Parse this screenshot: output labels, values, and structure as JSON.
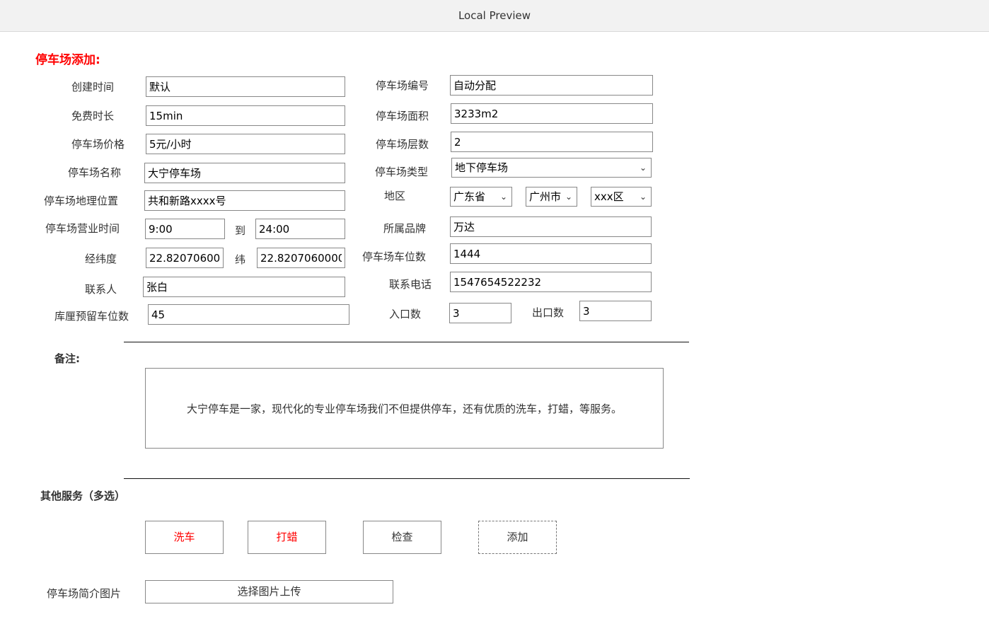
{
  "window": {
    "title": "Local Preview"
  },
  "page": {
    "heading": "停车场添加:"
  },
  "left": {
    "create_time": {
      "label": "创建时间",
      "value": "默认"
    },
    "free_duration": {
      "label": "免费时长",
      "value": "15min"
    },
    "price": {
      "label": "停车场价格",
      "value": "5元/小时"
    },
    "name": {
      "label": "停车场名称",
      "value": "大宁停车场"
    },
    "location": {
      "label": "停车场地理位置",
      "value": "共和新路xxxx号"
    },
    "hours": {
      "label": "停车场营业时间",
      "from": "9:00",
      "to_label": "到",
      "to": "24:00"
    },
    "coords": {
      "label": "经纬度",
      "lng": "22.82070600",
      "lat_label": "纬",
      "lat": "22.8207060000"
    },
    "contact": {
      "label": "联系人",
      "value": "张白"
    },
    "reserved": {
      "label": "库厘预留车位数",
      "value": "45"
    }
  },
  "right": {
    "number": {
      "label": "停车场编号",
      "value": "自动分配"
    },
    "area": {
      "label": "停车场面积",
      "value": "3233m2"
    },
    "floors": {
      "label": "停车场层数",
      "value": "2"
    },
    "type": {
      "label": "停车场类型",
      "value": "地下停车场"
    },
    "region": {
      "label": "地区",
      "province": "广东省",
      "city": "广州市",
      "district": "xxx区"
    },
    "brand": {
      "label": "所属品牌",
      "value": "万达"
    },
    "spaces": {
      "label": "停车场车位数",
      "value": "1444"
    },
    "phone": {
      "label": "联系电话",
      "value": "1547654522232"
    },
    "entrances": {
      "label": "入口数",
      "value": "3"
    },
    "exits": {
      "label": "出口数",
      "value": "3"
    }
  },
  "remarks": {
    "label": "备注:",
    "text": "大宁停车是一家，现代化的专业停车场我们不但提供停车，还有优质的洗车，打蜡，等服务。"
  },
  "services": {
    "label": "其他服务（多选）",
    "items": [
      "洗车",
      "打蜡",
      "检查"
    ],
    "add_label": "添加"
  },
  "image": {
    "label": "停车场简介图片",
    "button": "选择图片上传"
  },
  "colors": {
    "accent": "#ff0000",
    "border": "#888888"
  }
}
